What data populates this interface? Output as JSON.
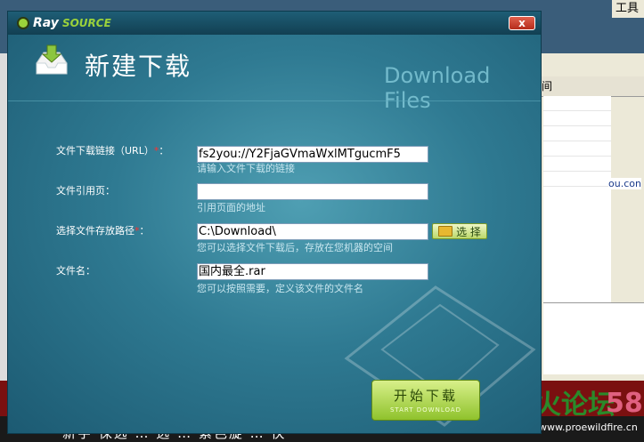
{
  "background": {
    "menu_text": "工具",
    "header_col": "间",
    "link_text": "ou.con",
    "bottom_text": "新宇 保选 …   选 … 紫色旋 … 快",
    "logo_text": "野火论坛",
    "logo_num": "58",
    "url_text": "www.proewildfire.cn"
  },
  "dialog": {
    "brand_ray": "Ray",
    "brand_source": "SOURCE",
    "close_label": "x",
    "title": "新建下载",
    "subtitle": "Download Files",
    "fields": [
      {
        "label": "文件下载链接（URL）",
        "required": true,
        "value": "fs2you://Y2FjaGVmaWxlMTgucmF5",
        "hint": "请输入文件下载的链接"
      },
      {
        "label": "文件引用页：",
        "required": false,
        "value": "",
        "hint": "引用页面的地址"
      },
      {
        "label": "选择文件存放路径",
        "required": true,
        "value": "C:\\Download\\",
        "hint": "您可以选择文件下载后，存放在您机器的空间"
      },
      {
        "label": "文件名：",
        "required": false,
        "value": "国内最全.rar",
        "hint": "您可以按照需要，定义该文件的文件名"
      }
    ],
    "choose_label": "选 择",
    "start_label": "开始下载",
    "start_sub": "START DOWNLOAD"
  },
  "colors": {
    "dialog_bg": "#2f7a92",
    "accent_green": "#9bd23b",
    "required_star": "#ff3030"
  }
}
